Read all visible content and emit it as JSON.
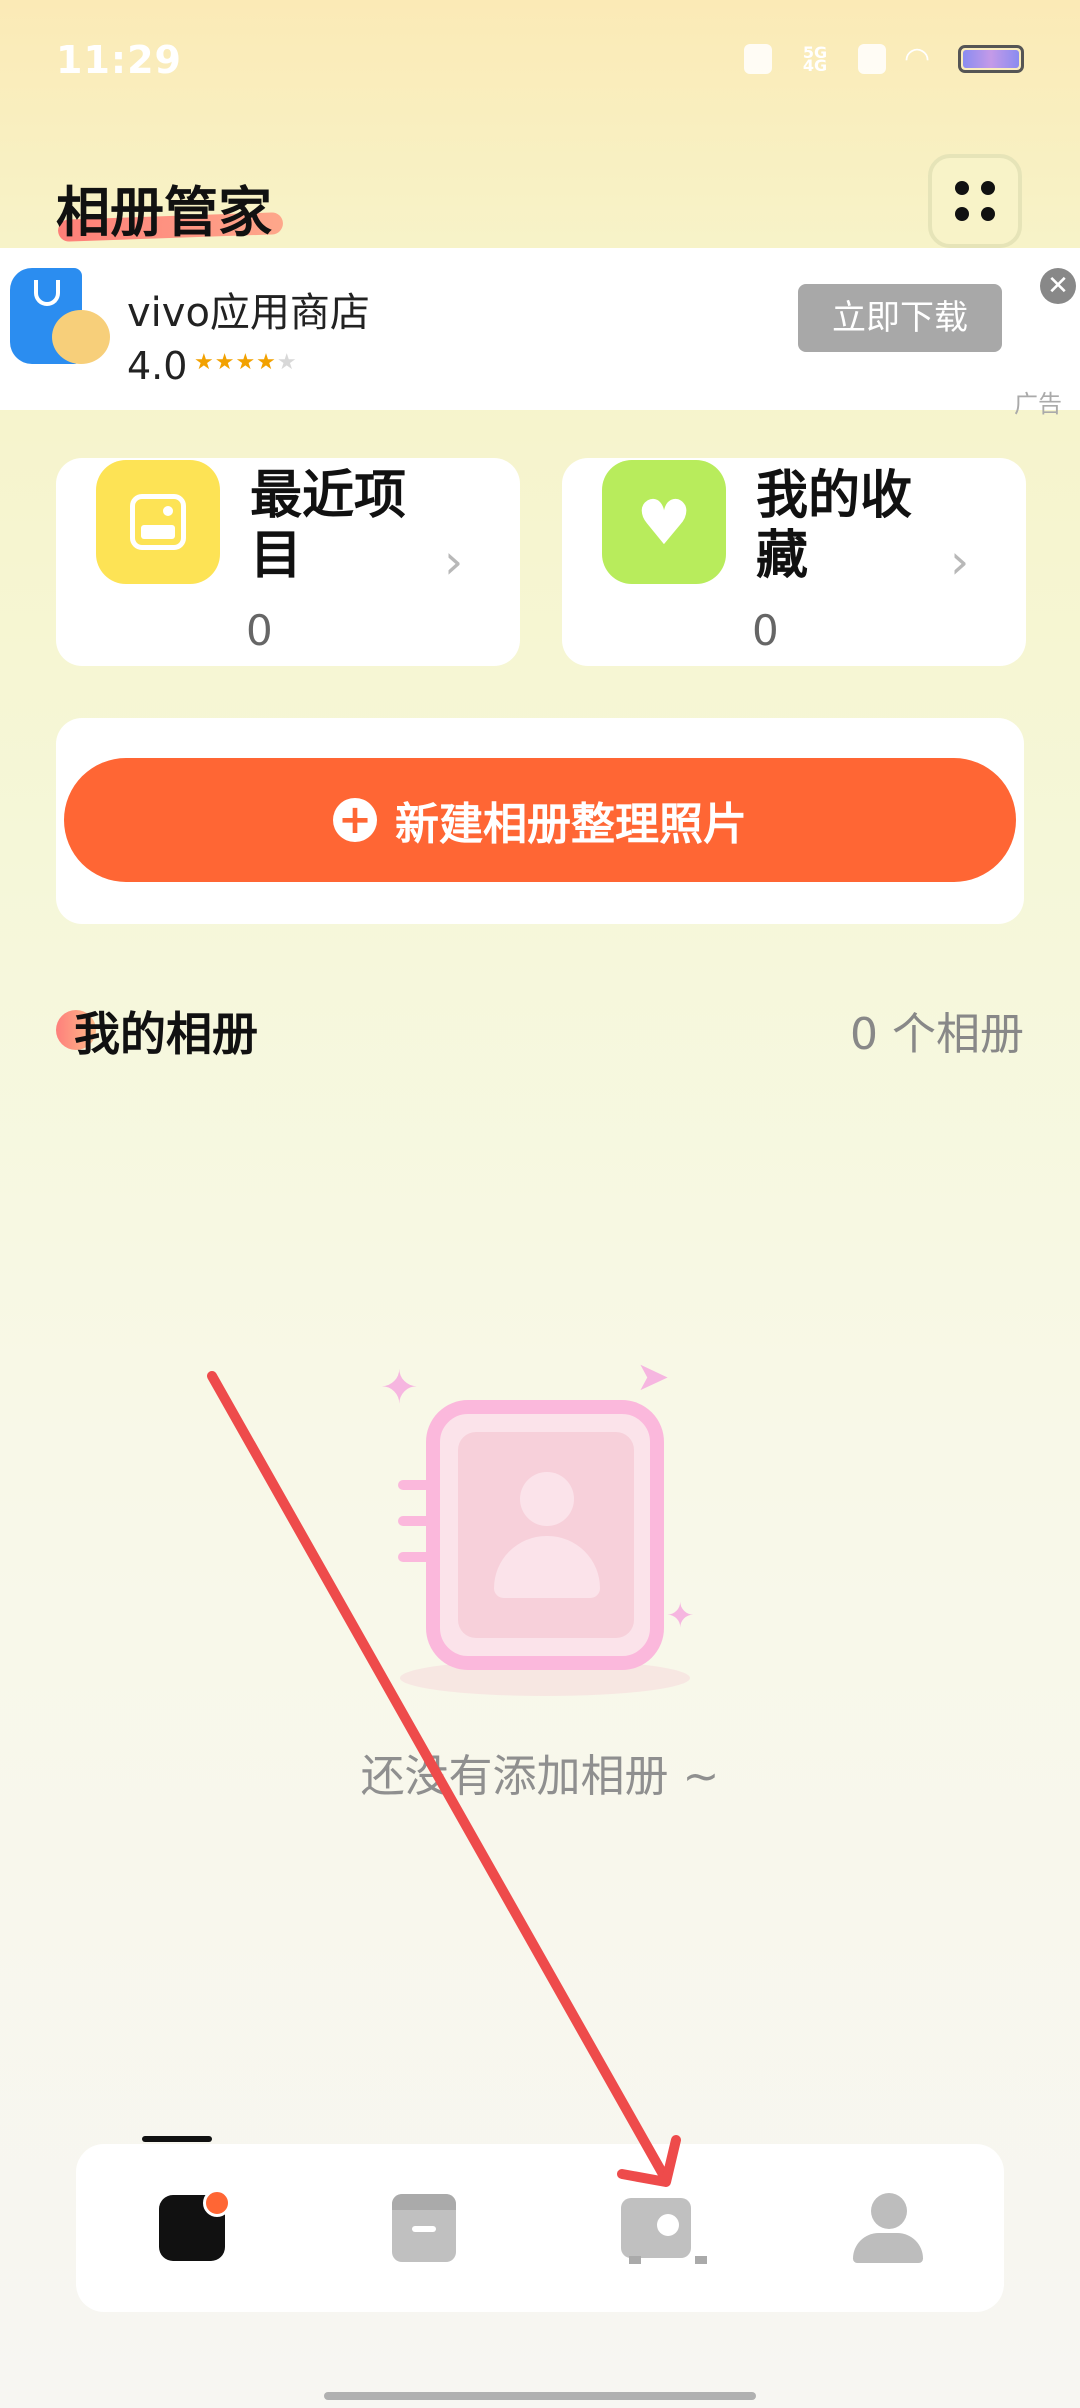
{
  "status_bar": {
    "time": "11:29",
    "network": "5G 4G",
    "icons": [
      "bluetooth-icon",
      "signal-icon",
      "sim-icon",
      "wifi-icon",
      "battery-icon"
    ]
  },
  "header": {
    "title": "相册管家",
    "menu_icon": "grid-dots-icon"
  },
  "ad": {
    "app_name": "vivo应用商店",
    "rating": "4.0",
    "stars": "★★★★",
    "stars_off": "★",
    "download_label": "立即下载",
    "close_label": "✕",
    "ad_label": "广告"
  },
  "quick_access": {
    "recent": {
      "label": "最近项目",
      "count": "0",
      "chevron": "›"
    },
    "favorites": {
      "label": "我的收藏",
      "count": "0",
      "chevron": "›"
    }
  },
  "create": {
    "label": "新建相册整理照片",
    "plus": "+"
  },
  "albums": {
    "title": "我的相册",
    "count_label": "0 个相册",
    "empty_text": "还没有添加相册 ~"
  },
  "bottom_nav": {
    "items": [
      "home-icon",
      "box-icon",
      "safe-icon",
      "profile-icon"
    ]
  },
  "colors": {
    "accent": "#ff6634",
    "recent_icon": "#fde355",
    "fav_icon": "#b8ec5c",
    "annotation_arrow": "#ee4b4b"
  }
}
